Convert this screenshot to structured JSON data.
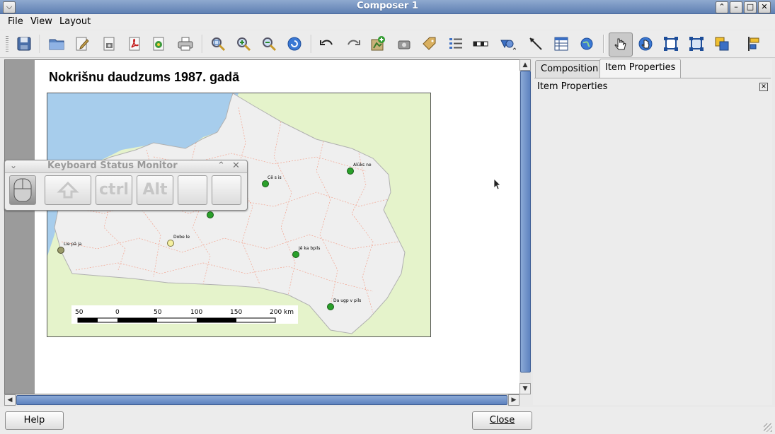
{
  "window": {
    "title": "Composer 1"
  },
  "menu": {
    "file": "File",
    "view": "View",
    "layout": "Layout"
  },
  "toolbar": {
    "items": [
      "save-icon",
      "open-folder-icon",
      "edit-template-icon",
      "export-image-icon",
      "export-pdf-icon",
      "export-svg-icon",
      "print-icon",
      "zoom-full-icon",
      "zoom-in-icon",
      "zoom-out-icon",
      "refresh-icon",
      "undo-icon",
      "redo-icon",
      "add-map-icon",
      "add-image-icon",
      "add-label-icon",
      "add-legend-icon",
      "add-scalebar-icon",
      "add-shape-icon",
      "add-arrow-icon",
      "add-table-icon",
      "add-html-icon",
      "select-move-icon",
      "move-content-icon",
      "group-icon",
      "ungroup-icon",
      "raise-lower-icon",
      "align-icon"
    ]
  },
  "map": {
    "title": "Nokrišnu daudzums 1987. gadā",
    "stations": [
      {
        "name": "Cē s is",
        "color": "#2aa02a"
      },
      {
        "name": "Alūks ne",
        "color": "#2aa02a"
      },
      {
        "name": "Dobe le",
        "color": "#f5f0a0"
      },
      {
        "name": "Lie pā ja",
        "color": "#9a9a6a"
      },
      {
        "name": "Jē ka bpils",
        "color": "#2aa02a"
      },
      {
        "name": "Da ugp v pils",
        "color": "#2aa02a"
      },
      {
        "name": "",
        "color": "#2aa02a"
      }
    ],
    "scalebar": {
      "labels": [
        "50",
        "0",
        "50",
        "100",
        "150",
        "200 km"
      ]
    }
  },
  "ksm": {
    "title": "Keyboard Status Monitor",
    "keys": [
      "",
      "ctrl",
      "Alt",
      "",
      ""
    ]
  },
  "panel": {
    "tabs": [
      "Composition",
      "Item Properties"
    ],
    "active_tab": "Item Properties",
    "header": "Item Properties"
  },
  "buttons": {
    "help": "Help",
    "close": "Close"
  }
}
